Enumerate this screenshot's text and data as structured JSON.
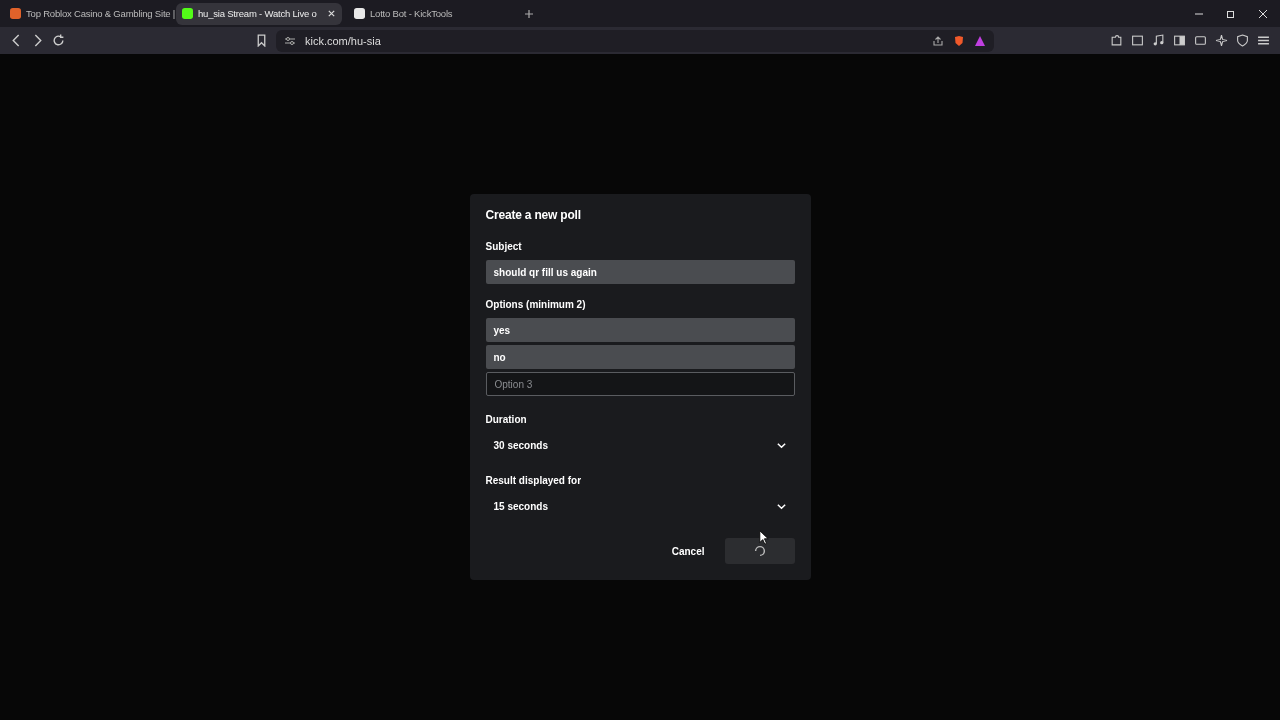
{
  "browser": {
    "tabs": [
      {
        "title": "Top Roblox Casino & Gambling Site |",
        "selected": false
      },
      {
        "title": "hu_sia Stream - Watch Live o",
        "selected": true
      },
      {
        "title": "Lotto Bot - KickTools",
        "selected": false
      }
    ],
    "url": "kick.com/hu-sia"
  },
  "modal": {
    "title": "Create a new poll",
    "subject_label": "Subject",
    "subject_value": "should qr fill us again",
    "options_label": "Options (minimum 2)",
    "options": [
      {
        "value": "yes"
      },
      {
        "value": "no"
      },
      {
        "placeholder": "Option 3"
      }
    ],
    "duration": {
      "label": "Duration",
      "value": "30 seconds"
    },
    "result": {
      "label": "Result displayed for",
      "value": "15 seconds"
    },
    "cancel": "Cancel",
    "submit_loading": true
  }
}
